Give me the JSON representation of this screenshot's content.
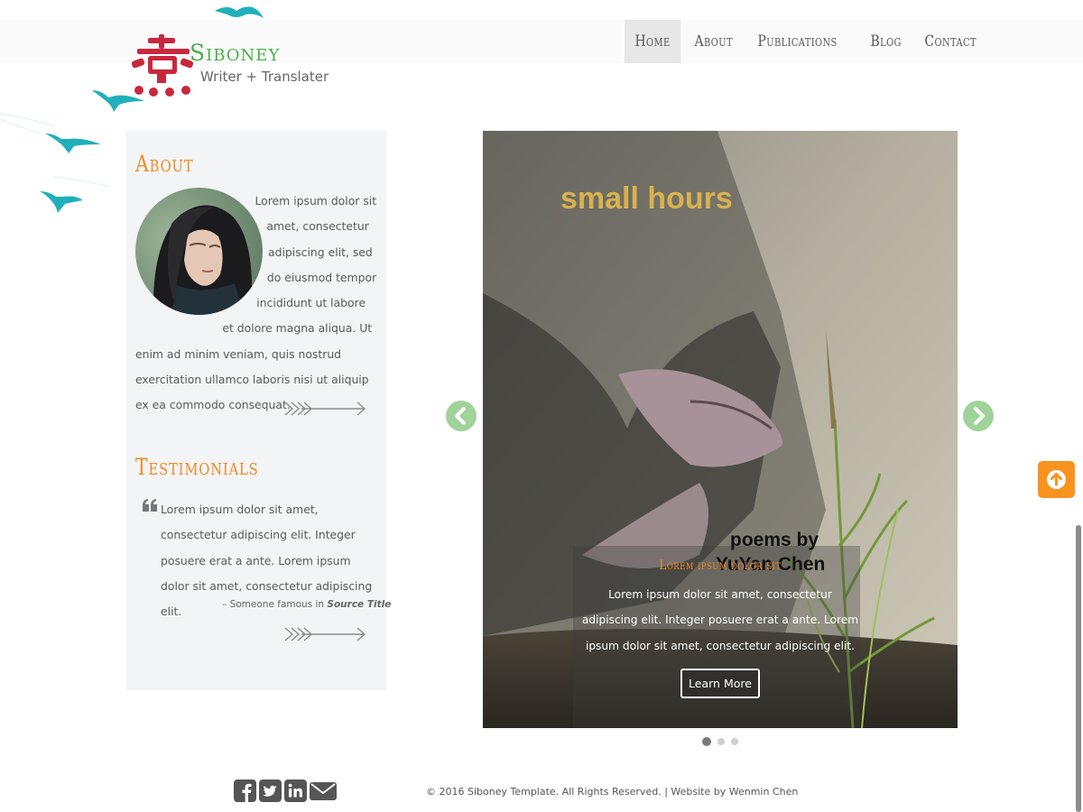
{
  "brand": {
    "name": "Siboney",
    "tagline": "Writer + Translater",
    "name_color": "#4cae4c"
  },
  "nav": {
    "items": [
      {
        "label": "Home",
        "active": true
      },
      {
        "label": "About",
        "active": false
      },
      {
        "label": "Publications",
        "active": false
      },
      {
        "label": "Blog",
        "active": false
      },
      {
        "label": "Contact",
        "active": false
      }
    ]
  },
  "sidebar": {
    "about": {
      "heading": "About",
      "text": "Lorem ipsum dolor sit amet, consectetur adipiscing elit, sed do eiusmod tempor incididunt ut labore et dolore magna aliqua. Ut enim ad minim veniam, quis nostrud exercitation ullamco laboris nisi ut aliquip ex ea commodo consequat."
    },
    "testimonials": {
      "heading": "Testimonials",
      "quote": "Lorem ipsum dolor sit amet, consectetur adipiscing elit. Integer posuere erat a ante. Lorem ipsum dolor sit amet, consectetur adipiscing elit.",
      "source_prefix": "– Someone famous in ",
      "source_title": "Source Title"
    },
    "heading_color": "#f08a24"
  },
  "carousel": {
    "slide": {
      "title": "small hours",
      "subtitle_line1": "poems by",
      "subtitle_line2": "YuYan Chen",
      "caption_heading": "Lorem ipsum dolor sit",
      "caption_text": "Lorem ipsum dolor sit amet, consectetur adipiscing elit. Integer posuere erat a ante. Lorem ipsum dolor sit amet, consectetur adipiscing elit.",
      "button_label": "Learn More"
    },
    "indicators": [
      {
        "active": true
      },
      {
        "active": false
      },
      {
        "active": false
      }
    ],
    "arrow_color": "#9fd39a"
  },
  "back_to_top": {
    "icon": "arrow-up-circle-icon",
    "color": "#f7931e"
  },
  "footer": {
    "social": [
      "facebook-icon",
      "twitter-icon",
      "linkedin-icon",
      "envelope-icon"
    ],
    "copyright": "© 2016 Siboney Template. All Rights Reserved. | Website by Wenmin Chen"
  }
}
